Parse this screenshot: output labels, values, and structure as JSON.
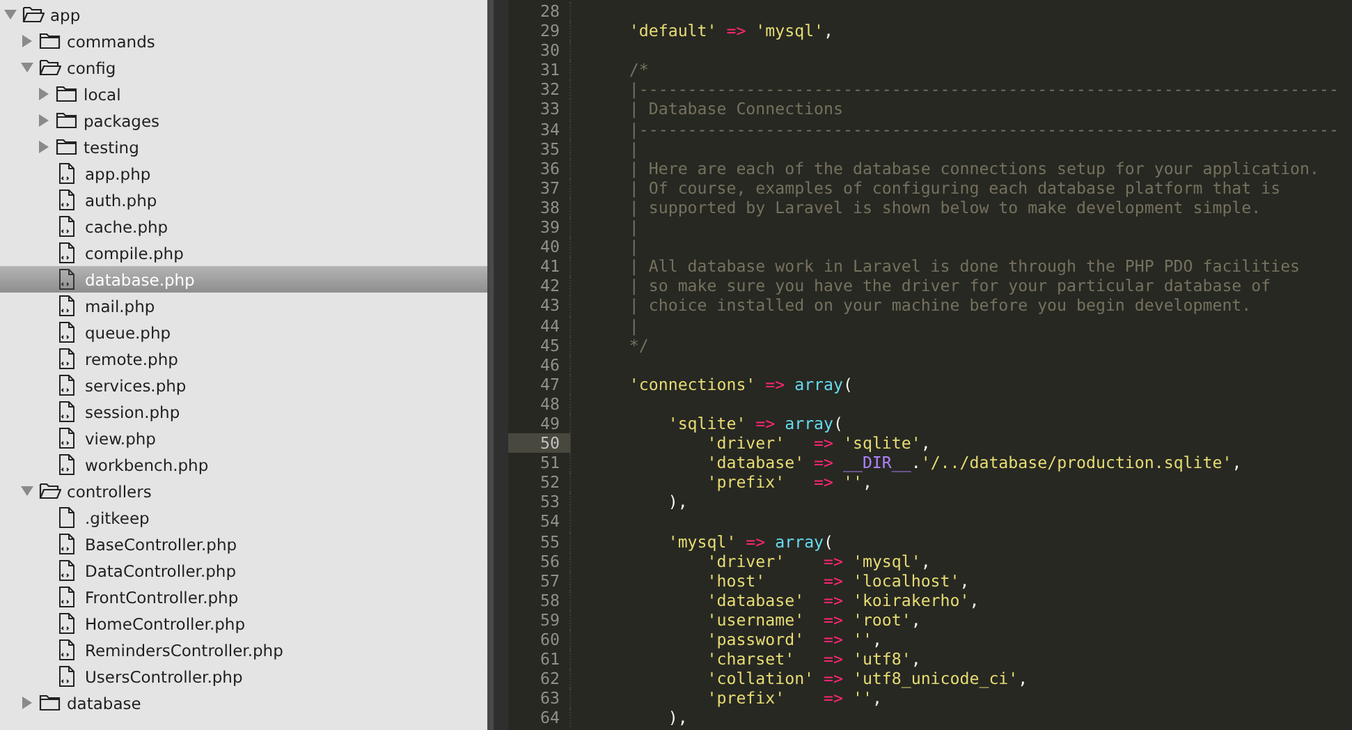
{
  "sidebar": {
    "tree": [
      {
        "name": "app",
        "kind": "folder",
        "expanded": true,
        "selected": false,
        "children": [
          {
            "name": "commands",
            "kind": "folder",
            "expanded": false,
            "selected": false
          },
          {
            "name": "config",
            "kind": "folder",
            "expanded": true,
            "selected": false,
            "children": [
              {
                "name": "local",
                "kind": "folder",
                "expanded": false,
                "selected": false
              },
              {
                "name": "packages",
                "kind": "folder",
                "expanded": false,
                "selected": false
              },
              {
                "name": "testing",
                "kind": "folder",
                "expanded": false,
                "selected": false
              },
              {
                "name": "app.php",
                "kind": "code-file",
                "selected": false
              },
              {
                "name": "auth.php",
                "kind": "code-file",
                "selected": false
              },
              {
                "name": "cache.php",
                "kind": "code-file",
                "selected": false
              },
              {
                "name": "compile.php",
                "kind": "code-file",
                "selected": false
              },
              {
                "name": "database.php",
                "kind": "code-file",
                "selected": true
              },
              {
                "name": "mail.php",
                "kind": "code-file",
                "selected": false
              },
              {
                "name": "queue.php",
                "kind": "code-file",
                "selected": false
              },
              {
                "name": "remote.php",
                "kind": "code-file",
                "selected": false
              },
              {
                "name": "services.php",
                "kind": "code-file",
                "selected": false
              },
              {
                "name": "session.php",
                "kind": "code-file",
                "selected": false
              },
              {
                "name": "view.php",
                "kind": "code-file",
                "selected": false
              },
              {
                "name": "workbench.php",
                "kind": "code-file",
                "selected": false
              }
            ]
          },
          {
            "name": "controllers",
            "kind": "folder",
            "expanded": true,
            "selected": false,
            "children": [
              {
                "name": ".gitkeep",
                "kind": "file",
                "selected": false
              },
              {
                "name": "BaseController.php",
                "kind": "code-file",
                "selected": false
              },
              {
                "name": "DataController.php",
                "kind": "code-file",
                "selected": false
              },
              {
                "name": "FrontController.php",
                "kind": "code-file",
                "selected": false
              },
              {
                "name": "HomeController.php",
                "kind": "code-file",
                "selected": false
              },
              {
                "name": "RemindersController.php",
                "kind": "code-file",
                "selected": false
              },
              {
                "name": "UsersController.php",
                "kind": "code-file",
                "selected": false
              }
            ]
          },
          {
            "name": "database",
            "kind": "folder",
            "expanded": false,
            "selected": false
          }
        ]
      }
    ]
  },
  "editor": {
    "lines": [
      {
        "number": "28",
        "current": false
      },
      {
        "number": "29",
        "current": false,
        "tokens": [
          {
            "kind": "string",
            "text": "    'default'"
          },
          {
            "kind": "operator",
            "text": " => "
          },
          {
            "kind": "string",
            "text": "'mysql'"
          },
          {
            "kind": "plain",
            "text": ","
          }
        ]
      },
      {
        "number": "30",
        "current": false
      },
      {
        "number": "31",
        "current": false,
        "tokens": [
          {
            "kind": "comment",
            "text": "    /*"
          }
        ]
      },
      {
        "number": "32",
        "current": false,
        "tokens": [
          {
            "kind": "comment",
            "text": "    |------------------------------------------------------------------------"
          }
        ]
      },
      {
        "number": "33",
        "current": false,
        "tokens": [
          {
            "kind": "comment",
            "text": "    | Database Connections"
          }
        ]
      },
      {
        "number": "34",
        "current": false,
        "tokens": [
          {
            "kind": "comment",
            "text": "    |------------------------------------------------------------------------"
          }
        ]
      },
      {
        "number": "35",
        "current": false,
        "tokens": [
          {
            "kind": "comment",
            "text": "    |"
          }
        ]
      },
      {
        "number": "36",
        "current": false,
        "tokens": [
          {
            "kind": "comment",
            "text": "    | Here are each of the database connections setup for your application."
          }
        ]
      },
      {
        "number": "37",
        "current": false,
        "tokens": [
          {
            "kind": "comment",
            "text": "    | Of course, examples of configuring each database platform that is"
          }
        ]
      },
      {
        "number": "38",
        "current": false,
        "tokens": [
          {
            "kind": "comment",
            "text": "    | supported by Laravel is shown below to make development simple."
          }
        ]
      },
      {
        "number": "39",
        "current": false,
        "tokens": [
          {
            "kind": "comment",
            "text": "    |"
          }
        ]
      },
      {
        "number": "40",
        "current": false,
        "tokens": [
          {
            "kind": "comment",
            "text": "    |"
          }
        ]
      },
      {
        "number": "41",
        "current": false,
        "tokens": [
          {
            "kind": "comment",
            "text": "    | All database work in Laravel is done through the PHP PDO facilities"
          }
        ]
      },
      {
        "number": "42",
        "current": false,
        "tokens": [
          {
            "kind": "comment",
            "text": "    | so make sure you have the driver for your particular database of"
          }
        ]
      },
      {
        "number": "43",
        "current": false,
        "tokens": [
          {
            "kind": "comment",
            "text": "    | choice installed on your machine before you begin development."
          }
        ]
      },
      {
        "number": "44",
        "current": false,
        "tokens": [
          {
            "kind": "comment",
            "text": "    |"
          }
        ]
      },
      {
        "number": "45",
        "current": false,
        "tokens": [
          {
            "kind": "comment",
            "text": "    */"
          }
        ]
      },
      {
        "number": "46",
        "current": false
      },
      {
        "number": "47",
        "current": false,
        "tokens": [
          {
            "kind": "string",
            "text": "    'connections'"
          },
          {
            "kind": "operator",
            "text": " => "
          },
          {
            "kind": "keyword",
            "text": "array"
          },
          {
            "kind": "plain",
            "text": "("
          }
        ]
      },
      {
        "number": "48",
        "current": false
      },
      {
        "number": "49",
        "current": false,
        "tokens": [
          {
            "kind": "string",
            "text": "        'sqlite'"
          },
          {
            "kind": "operator",
            "text": " => "
          },
          {
            "kind": "keyword",
            "text": "array"
          },
          {
            "kind": "plain",
            "text": "("
          }
        ]
      },
      {
        "number": "50",
        "current": true,
        "tokens": [
          {
            "kind": "string",
            "text": "            'driver'"
          },
          {
            "kind": "operator",
            "text": "   => "
          },
          {
            "kind": "string",
            "text": "'sqlite'"
          },
          {
            "kind": "plain",
            "text": ","
          }
        ]
      },
      {
        "number": "51",
        "current": false,
        "tokens": [
          {
            "kind": "string",
            "text": "            'database'"
          },
          {
            "kind": "operator",
            "text": " => "
          },
          {
            "kind": "constant",
            "text": "__DIR__"
          },
          {
            "kind": "plain",
            "text": "."
          },
          {
            "kind": "string",
            "text": "'/../database/production.sqlite'"
          },
          {
            "kind": "plain",
            "text": ","
          }
        ]
      },
      {
        "number": "52",
        "current": false,
        "tokens": [
          {
            "kind": "string",
            "text": "            'prefix'"
          },
          {
            "kind": "operator",
            "text": "   => "
          },
          {
            "kind": "string",
            "text": "''"
          },
          {
            "kind": "plain",
            "text": ","
          }
        ]
      },
      {
        "number": "53",
        "current": false,
        "tokens": [
          {
            "kind": "plain",
            "text": "        ),"
          }
        ]
      },
      {
        "number": "54",
        "current": false
      },
      {
        "number": "55",
        "current": false,
        "tokens": [
          {
            "kind": "string",
            "text": "        'mysql'"
          },
          {
            "kind": "operator",
            "text": " => "
          },
          {
            "kind": "keyword",
            "text": "array"
          },
          {
            "kind": "plain",
            "text": "("
          }
        ]
      },
      {
        "number": "56",
        "current": false,
        "tokens": [
          {
            "kind": "string",
            "text": "            'driver'"
          },
          {
            "kind": "operator",
            "text": "    => "
          },
          {
            "kind": "string",
            "text": "'mysql'"
          },
          {
            "kind": "plain",
            "text": ","
          }
        ]
      },
      {
        "number": "57",
        "current": false,
        "tokens": [
          {
            "kind": "string",
            "text": "            'host'"
          },
          {
            "kind": "operator",
            "text": "      => "
          },
          {
            "kind": "string",
            "text": "'localhost'"
          },
          {
            "kind": "plain",
            "text": ","
          }
        ]
      },
      {
        "number": "58",
        "current": false,
        "tokens": [
          {
            "kind": "string",
            "text": "            'database'"
          },
          {
            "kind": "operator",
            "text": "  => "
          },
          {
            "kind": "string",
            "text": "'koirakerho'"
          },
          {
            "kind": "plain",
            "text": ","
          }
        ]
      },
      {
        "number": "59",
        "current": false,
        "tokens": [
          {
            "kind": "string",
            "text": "            'username'"
          },
          {
            "kind": "operator",
            "text": "  => "
          },
          {
            "kind": "string",
            "text": "'root'"
          },
          {
            "kind": "plain",
            "text": ","
          }
        ]
      },
      {
        "number": "60",
        "current": false,
        "tokens": [
          {
            "kind": "string",
            "text": "            'password'"
          },
          {
            "kind": "operator",
            "text": "  => "
          },
          {
            "kind": "string",
            "text": "''"
          },
          {
            "kind": "plain",
            "text": ","
          }
        ]
      },
      {
        "number": "61",
        "current": false,
        "tokens": [
          {
            "kind": "string",
            "text": "            'charset'"
          },
          {
            "kind": "operator",
            "text": "   => "
          },
          {
            "kind": "string",
            "text": "'utf8'"
          },
          {
            "kind": "plain",
            "text": ","
          }
        ]
      },
      {
        "number": "62",
        "current": false,
        "tokens": [
          {
            "kind": "string",
            "text": "            'collation'"
          },
          {
            "kind": "operator",
            "text": " => "
          },
          {
            "kind": "string",
            "text": "'utf8_unicode_ci'"
          },
          {
            "kind": "plain",
            "text": ","
          }
        ]
      },
      {
        "number": "63",
        "current": false,
        "tokens": [
          {
            "kind": "string",
            "text": "            'prefix'"
          },
          {
            "kind": "operator",
            "text": "    => "
          },
          {
            "kind": "string",
            "text": "''"
          },
          {
            "kind": "plain",
            "text": ","
          }
        ]
      },
      {
        "number": "64",
        "current": false,
        "tokens": [
          {
            "kind": "plain",
            "text": "        ),"
          }
        ]
      }
    ]
  }
}
